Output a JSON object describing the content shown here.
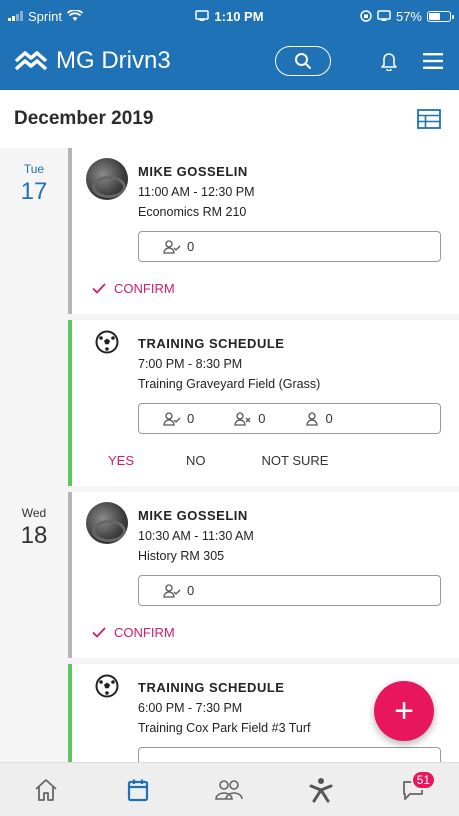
{
  "status_bar": {
    "carrier": "Sprint",
    "time": "1:10 PM",
    "battery": "57%",
    "battery_level": 0.57
  },
  "header": {
    "app_name": "MG Drivn3",
    "brand_color": "#1e72b5"
  },
  "calendar": {
    "month": "December 2019",
    "days": [
      {
        "dow": "Tue",
        "num": "17",
        "events": [
          {
            "type": "class",
            "name": "MIKE GOSSELIN",
            "time": "11:00 AM - 12:30 PM",
            "location": "Economics RM 210",
            "attending": "0",
            "action": "CONFIRM"
          },
          {
            "type": "training",
            "name": "TRAINING SCHEDULE",
            "time": "7:00 PM - 8:30 PM",
            "location": "Training Graveyard Field (Grass)",
            "attending": "0",
            "declined": "0",
            "unsure": "0",
            "yes": "YES",
            "no": "NO",
            "not_sure": "NOT SURE"
          }
        ]
      },
      {
        "dow": "Wed",
        "num": "18",
        "events": [
          {
            "type": "class",
            "name": "MIKE GOSSELIN",
            "time": "10:30 AM - 11:30 AM",
            "location": "History RM 305",
            "attending": "0",
            "action": "CONFIRM"
          },
          {
            "type": "training",
            "name": "TRAINING SCHEDULE",
            "time": "6:00 PM - 7:30 PM",
            "location": "Training Cox Park Field #3 Turf"
          }
        ]
      }
    ]
  },
  "fab": {
    "label": "+"
  },
  "bottom_nav": {
    "items": [
      "home-icon",
      "calendar-icon",
      "team-icon",
      "activity-icon",
      "chat-icon"
    ],
    "chat_badge": "51"
  },
  "colors": {
    "accent_pink": "#d01c6c",
    "fab": "#e8175d",
    "training_bar": "#5cc85c",
    "class_bar": "#b5b5b5"
  }
}
